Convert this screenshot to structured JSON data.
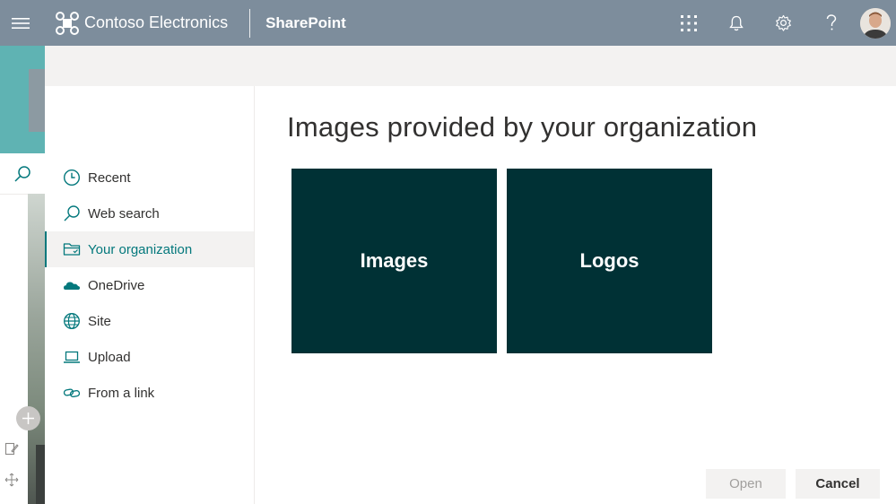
{
  "suite_bar": {
    "company": "Contoso Electronics",
    "app": "SharePoint",
    "icons": [
      "waffle-menu-icon",
      "app-launcher-icon",
      "bell-icon",
      "gear-icon",
      "help-icon"
    ]
  },
  "dialog": {
    "title": "Images provided by your organization",
    "nav": [
      {
        "label": "Recent",
        "icon": "clock-icon"
      },
      {
        "label": "Web search",
        "icon": "search-icon"
      },
      {
        "label": "Your organization",
        "icon": "folder-icon",
        "selected": true
      },
      {
        "label": "OneDrive",
        "icon": "cloud-icon"
      },
      {
        "label": "Site",
        "icon": "globe-icon"
      },
      {
        "label": "Upload",
        "icon": "laptop-icon"
      },
      {
        "label": "From a link",
        "icon": "link-icon"
      }
    ],
    "tiles": [
      {
        "label": "Images"
      },
      {
        "label": "Logos"
      }
    ],
    "buttons": {
      "open": "Open",
      "cancel": "Cancel"
    }
  },
  "colors": {
    "suite_bar": "#7d8d9c",
    "accent": "#03787c",
    "tile": "#003135"
  }
}
